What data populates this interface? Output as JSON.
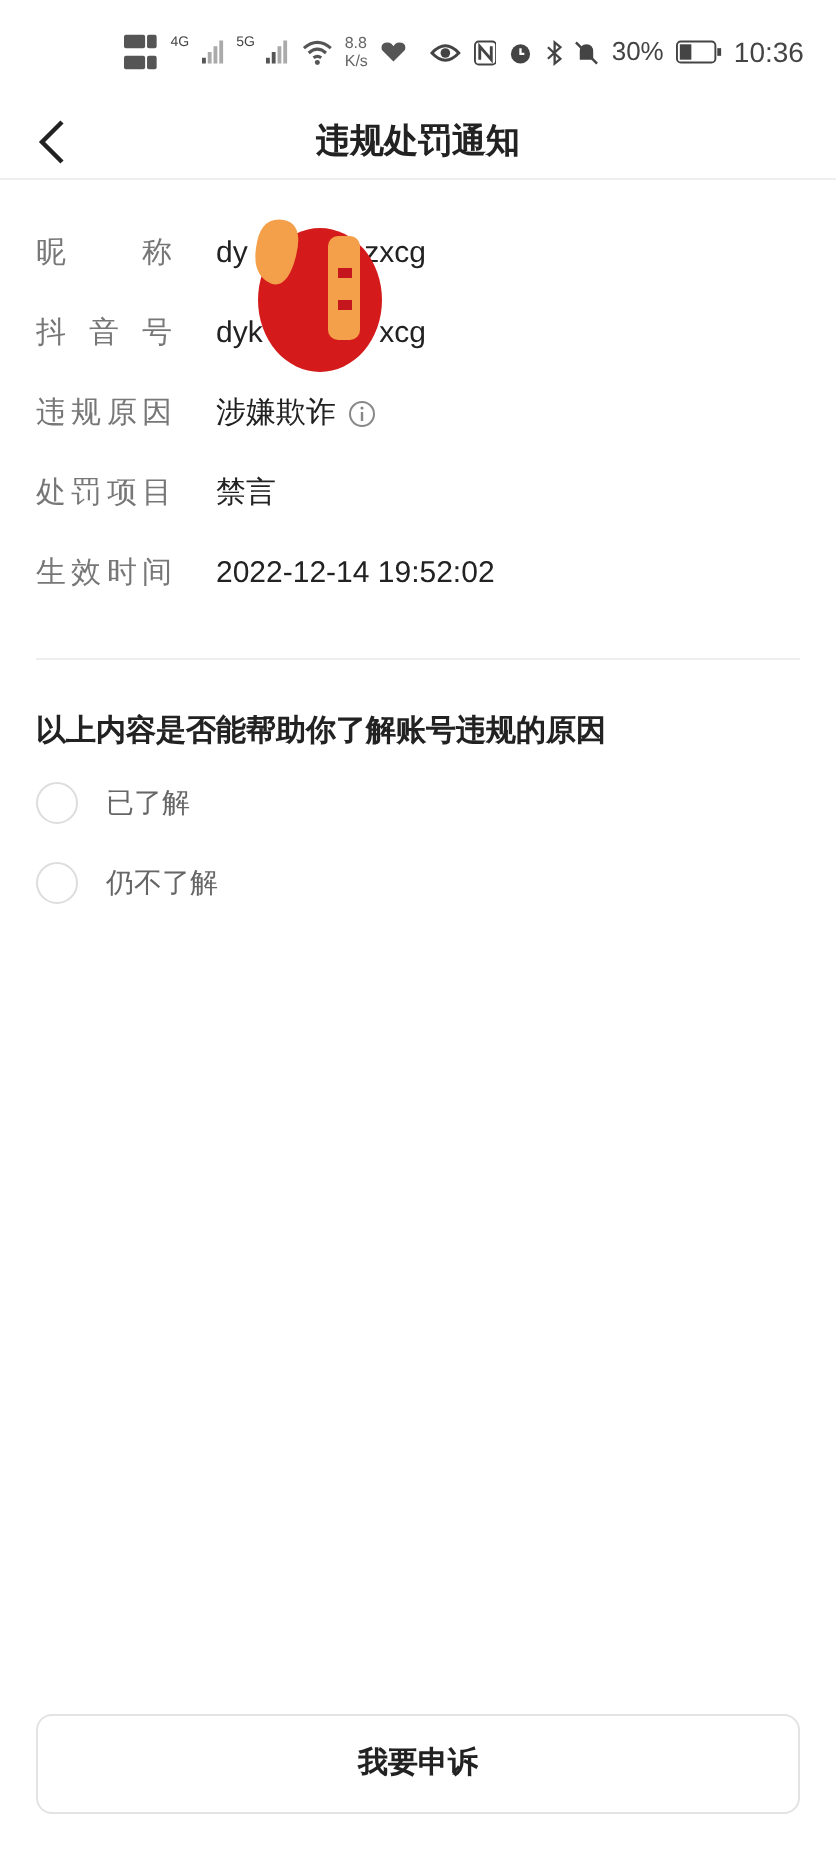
{
  "status_bar": {
    "network_1": "4G",
    "network_2": "5G",
    "speed_value": "8.8",
    "speed_unit": "K/s",
    "battery": "30%",
    "time": "10:36"
  },
  "header": {
    "title": "违规处罚通知"
  },
  "details": [
    {
      "label": "昵称",
      "value_parts": [
        "dy",
        "zxcg"
      ],
      "kind": "split"
    },
    {
      "label": "抖音号",
      "value_parts": [
        "dyk",
        "xcg"
      ],
      "kind": "split"
    },
    {
      "label": "违规原因",
      "value_parts": [
        "涉嫌欺诈"
      ],
      "kind": "info"
    },
    {
      "label": "处罚项目",
      "value_parts": [
        "禁言"
      ],
      "kind": "plain"
    },
    {
      "label": "生效时间",
      "value_parts": [
        "2022-12-14 19:52:02"
      ],
      "kind": "plain"
    }
  ],
  "survey": {
    "question": "以上内容是否能帮助你了解账号违规的原因",
    "options": [
      {
        "label": "已了解",
        "selected": false
      },
      {
        "label": "仍不了解",
        "selected": false
      }
    ]
  },
  "appeal_button": "我要申诉"
}
